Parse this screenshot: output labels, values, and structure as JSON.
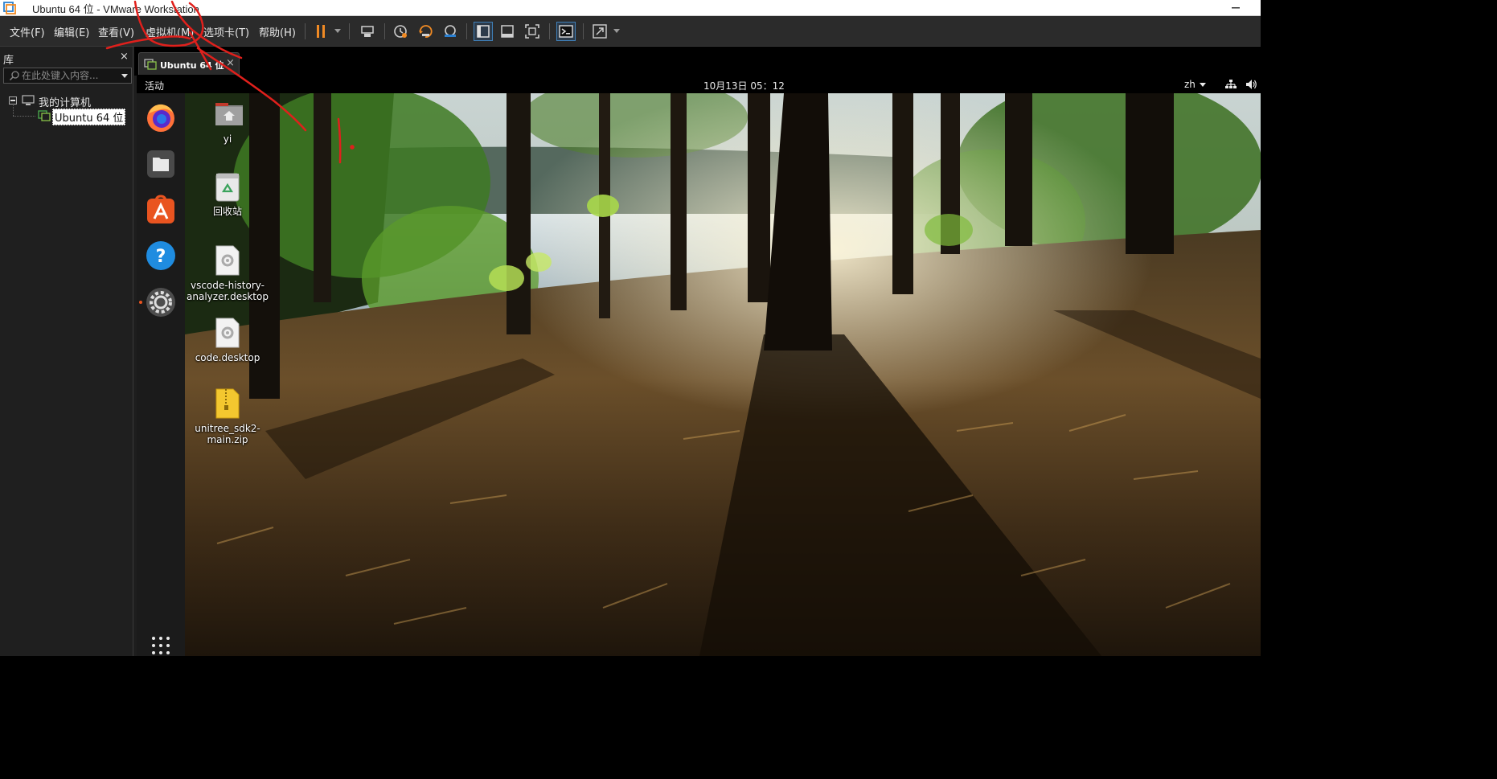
{
  "window": {
    "title": "Ubuntu 64 位 - VMware Workstation",
    "icon": "vmware-icon"
  },
  "menu": {
    "items": [
      "文件(F)",
      "编辑(E)",
      "查看(V)",
      "虚拟机(M)",
      "选项卡(T)",
      "帮助(H)"
    ]
  },
  "toolbar": {
    "icons": [
      "pause-icon",
      "send-ctrl-alt-del-icon",
      "snapshot-icon",
      "revert-snapshot-icon",
      "snapshot-manager-icon",
      "library-view-icon",
      "thumbnail-view-icon",
      "fullscreen-view-icon",
      "console-view-icon",
      "stretch-icon"
    ],
    "accent": "#f08a24"
  },
  "library": {
    "title": "库",
    "close": "×",
    "search_placeholder": "在此处键入内容...",
    "tree": {
      "root": "我的计算机",
      "child": "Ubuntu 64 位"
    }
  },
  "vm_tab": {
    "label": "Ubuntu 64 位",
    "close": "×"
  },
  "gnome": {
    "activities": "活动",
    "clock": "10月13日  05：12",
    "lang": "zh"
  },
  "dock": {
    "items": [
      "firefox-icon",
      "files-icon",
      "software-icon",
      "help-icon",
      "settings-icon"
    ],
    "apps_grid": "show-apps-icon"
  },
  "desktop": {
    "icons": [
      {
        "label": "yi",
        "type": "home-folder"
      },
      {
        "label": "回收站",
        "type": "trash"
      },
      {
        "label": "vscode-history-analyzer.desktop",
        "type": "desktop-file"
      },
      {
        "label": "code.desktop",
        "type": "desktop-file"
      },
      {
        "label": "unitree_sdk2-main.zip",
        "type": "zip-archive"
      }
    ]
  },
  "colors": {
    "ubuntu_orange": "#e95420",
    "annotation_red": "#e0201c"
  }
}
